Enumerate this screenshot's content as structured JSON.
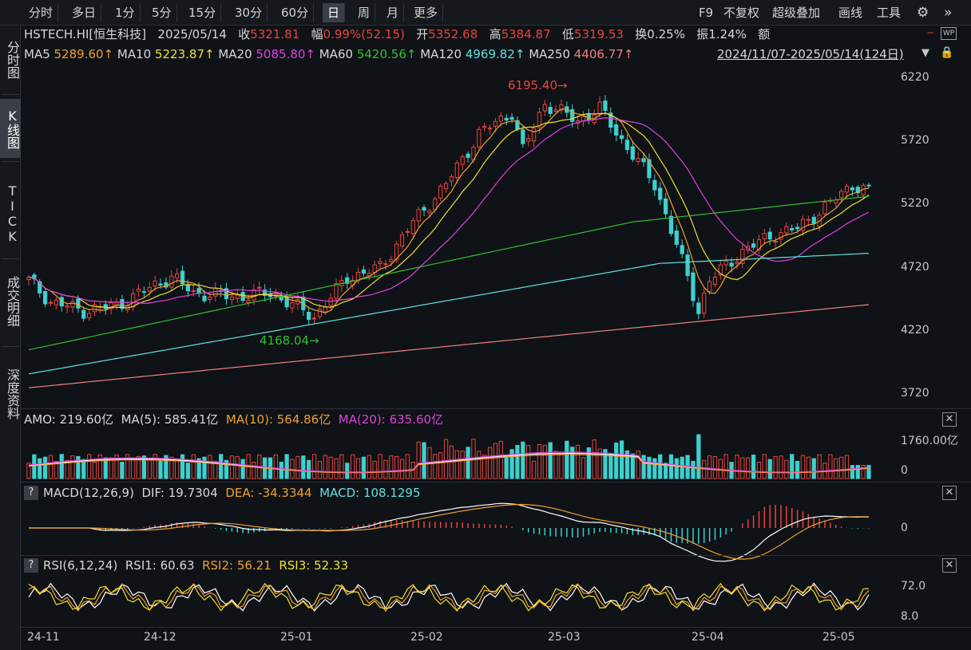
{
  "toolbar": {
    "timeframes": [
      "分时",
      "多日",
      "1分",
      "5分",
      "15分",
      "30分",
      "60分",
      "日",
      "周",
      "月",
      "更多"
    ],
    "active_timeframe": "日",
    "right": {
      "f9": "F9",
      "adjust": "不复权",
      "overlay": "超级叠加",
      "draw": "画线",
      "tools": "工具"
    }
  },
  "sidebar": {
    "tabs": [
      "分时图",
      "K线图",
      "TICK",
      "成交明细",
      "深度资料"
    ],
    "active": "K线图"
  },
  "quote": {
    "symbol": "HSTECH.HI[恒生科技]",
    "date": "2025/05/14",
    "close_label": "收",
    "close": "5321.81",
    "change_label": "幅",
    "change": "0.99%(52.15)",
    "open_label": "开",
    "open": "5352.68",
    "high_label": "高",
    "high": "5384.87",
    "low_label": "低",
    "low": "5319.53",
    "turnover_label": "换",
    "turnover": "0.25%",
    "amplitude_label": "振",
    "amplitude": "1.24%",
    "amount_label": "额"
  },
  "ma_legend": [
    {
      "label": "MA5",
      "value": "5289.60↑",
      "color": "#f0a030"
    },
    {
      "label": "MA10",
      "value": "5223.87↑",
      "color": "#f0e030"
    },
    {
      "label": "MA20",
      "value": "5085.80↑",
      "color": "#e040e0"
    },
    {
      "label": "MA60",
      "value": "5420.56↑",
      "color": "#30c030"
    },
    {
      "label": "MA120",
      "value": "4969.82↑",
      "color": "#60e0e0"
    },
    {
      "label": "MA250",
      "value": "4406.77↑",
      "color": "#f08080"
    }
  ],
  "range_text": "2024/11/07-2025/05/14(124日)",
  "price_axis": {
    "ticks": [
      "6220",
      "5720",
      "5220",
      "4720",
      "4220",
      "3720"
    ],
    "values": [
      6220,
      5720,
      5220,
      4720,
      4220,
      3720
    ]
  },
  "annotations": {
    "high": "6195.40",
    "low": "4168.04"
  },
  "volume_panel": {
    "label": "AMO: 219.60亿",
    "ma5": "MA(5): 585.41亿",
    "ma10": "MA(10): 564.86亿",
    "ma20": "MA(20): 635.60亿",
    "axis_top": "1760.00亿",
    "axis_zero": "0"
  },
  "macd_panel": {
    "label": "MACD(12,26,9)",
    "dif": "DIF: 19.7304",
    "dea": "DEA: -34.3344",
    "macd": "MACD: 108.1295",
    "axis_zero": "0"
  },
  "rsi_panel": {
    "label": "RSI(6,12,24)",
    "rsi1": "RSI1: 60.63",
    "rsi2": "RSI2: 56.21",
    "rsi3": "RSI3: 52.33",
    "axis_high": "72.0",
    "axis_low": "8.0"
  },
  "date_axis": [
    "24-11",
    "24-12",
    "25-01",
    "25-02",
    "25-03",
    "25-04",
    "25-05"
  ],
  "colors": {
    "up": "#e8453c",
    "down": "#3cd0d0",
    "vol_up": "#e8453c",
    "vol_down": "#3cd0d0"
  },
  "chart_data": {
    "type": "candlestick",
    "ylim": [
      3620,
      6320
    ],
    "ohlc_anchors": [
      {
        "i": 0,
        "c": 4620
      },
      {
        "i": 4,
        "c": 4450
      },
      {
        "i": 10,
        "c": 4380
      },
      {
        "i": 16,
        "c": 4420
      },
      {
        "i": 22,
        "c": 4560
      },
      {
        "i": 26,
        "c": 4650
      },
      {
        "i": 30,
        "c": 4520
      },
      {
        "i": 38,
        "c": 4490
      },
      {
        "i": 44,
        "c": 4520
      },
      {
        "i": 50,
        "c": 4380
      },
      {
        "i": 52,
        "c": 4330
      },
      {
        "i": 58,
        "c": 4640
      },
      {
        "i": 64,
        "c": 4720
      },
      {
        "i": 70,
        "c": 5080
      },
      {
        "i": 76,
        "c": 5380
      },
      {
        "i": 82,
        "c": 5780
      },
      {
        "i": 88,
        "c": 5950
      },
      {
        "i": 90,
        "c": 5650
      },
      {
        "i": 94,
        "c": 6020
      },
      {
        "i": 100,
        "c": 5880
      },
      {
        "i": 104,
        "c": 5980
      },
      {
        "i": 108,
        "c": 5730
      },
      {
        "i": 114,
        "c": 5380
      },
      {
        "i": 118,
        "c": 4900
      },
      {
        "i": 122,
        "c": 4380
      },
      {
        "i": 124,
        "c": 4620
      },
      {
        "i": 130,
        "c": 4850
      },
      {
        "i": 136,
        "c": 4990
      },
      {
        "i": 140,
        "c": 5030
      },
      {
        "i": 146,
        "c": 5230
      },
      {
        "i": 150,
        "c": 5380
      },
      {
        "i": 153,
        "c": 5322
      }
    ]
  }
}
